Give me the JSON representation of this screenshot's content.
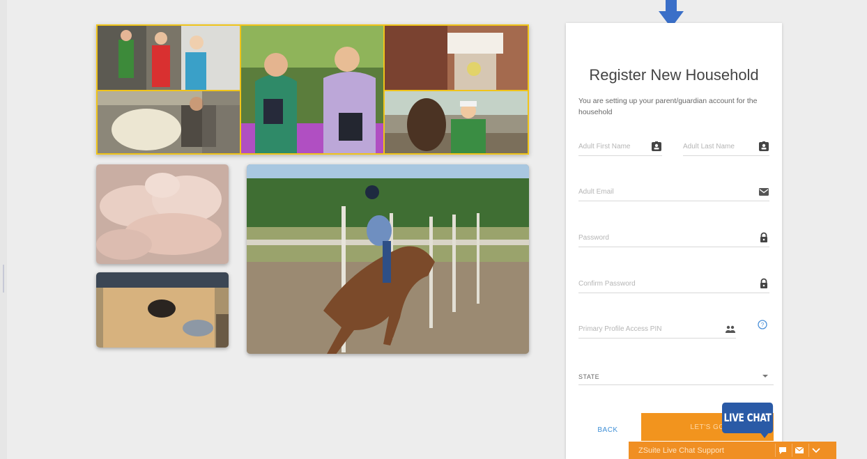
{
  "register": {
    "title": "Register New Household",
    "intro": "You are setting up your parent/guardian account for the household",
    "fields": {
      "first_name": "Adult First Name",
      "last_name": "Adult Last Name",
      "email": "Adult Email",
      "password": "Password",
      "confirm_password": "Confirm Password",
      "pin": "Primary Profile Access PIN"
    },
    "state_label": "STATE",
    "back_label": "BACK",
    "submit_label": "LET'S GO"
  },
  "live_chat": {
    "badge": "LIVE CHAT",
    "bar_label": "ZSuite Live Chat Support"
  },
  "colors": {
    "accent_orange": "#f2941e",
    "chat_blue": "#2a5aa6",
    "link_blue": "#3f8fd6",
    "collage_border": "#f0c419"
  },
  "icons": [
    "arrow-down-icon",
    "contact-card-icon",
    "mail-icon",
    "lock-icon",
    "people-icon",
    "help-icon",
    "chevron-down-icon",
    "chat-bubble-icon"
  ]
}
